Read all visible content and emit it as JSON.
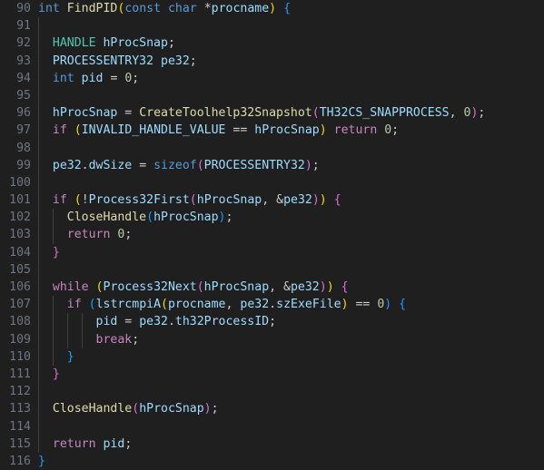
{
  "editor": {
    "name": "code-editor",
    "theme": "Dark Modern",
    "language": "C",
    "background": "#1f1f1f",
    "gutter_color": "#6e7681",
    "indent_guide_color": "#404040",
    "first_line_number": 90,
    "last_line_number": 116,
    "line_height_px": 19.19,
    "font_size_px": 13.2,
    "palette": {
      "keyword": "#569cd6",
      "control": "#c586c0",
      "function": "#dcdcaa",
      "type": "#4ec9b0",
      "variable": "#9cdcfe",
      "number": "#b5cea8",
      "plain": "#cccccc",
      "bracket_1": "#ffd700",
      "bracket_2": "#da70d6",
      "bracket_3": "#179fff"
    }
  },
  "lines": [
    {
      "num": "90",
      "text": "int FindPID(const char *procname) {",
      "guides": 0
    },
    {
      "num": "91",
      "text": "",
      "guides": 1
    },
    {
      "num": "92",
      "text": "  HANDLE hProcSnap;",
      "guides": 1
    },
    {
      "num": "93",
      "text": "  PROCESSENTRY32 pe32;",
      "guides": 1
    },
    {
      "num": "94",
      "text": "  int pid = 0;",
      "guides": 1
    },
    {
      "num": "95",
      "text": "",
      "guides": 1
    },
    {
      "num": "96",
      "text": "  hProcSnap = CreateToolhelp32Snapshot(TH32CS_SNAPPROCESS, 0);",
      "guides": 1
    },
    {
      "num": "97",
      "text": "  if (INVALID_HANDLE_VALUE == hProcSnap) return 0;",
      "guides": 1
    },
    {
      "num": "98",
      "text": "",
      "guides": 1
    },
    {
      "num": "99",
      "text": "  pe32.dwSize = sizeof(PROCESSENTRY32);",
      "guides": 1
    },
    {
      "num": "100",
      "text": "",
      "guides": 1
    },
    {
      "num": "101",
      "text": "  if (!Process32First(hProcSnap, &pe32)) {",
      "guides": 1
    },
    {
      "num": "102",
      "text": "    CloseHandle(hProcSnap);",
      "guides": 2
    },
    {
      "num": "103",
      "text": "    return 0;",
      "guides": 2
    },
    {
      "num": "104",
      "text": "  }",
      "guides": 1
    },
    {
      "num": "105",
      "text": "",
      "guides": 1
    },
    {
      "num": "106",
      "text": "  while (Process32Next(hProcSnap, &pe32)) {",
      "guides": 1
    },
    {
      "num": "107",
      "text": "    if (lstrcmpiA(procname, pe32.szExeFile) == 0) {",
      "guides": 2
    },
    {
      "num": "108",
      "text": "        pid = pe32.th32ProcessID;",
      "guides": 4
    },
    {
      "num": "109",
      "text": "        break;",
      "guides": 4
    },
    {
      "num": "110",
      "text": "    }",
      "guides": 2
    },
    {
      "num": "111",
      "text": "  }",
      "guides": 1
    },
    {
      "num": "112",
      "text": "",
      "guides": 1
    },
    {
      "num": "113",
      "text": "  CloseHandle(hProcSnap);",
      "guides": 1
    },
    {
      "num": "114",
      "text": "",
      "guides": 1
    },
    {
      "num": "115",
      "text": "  return pid;",
      "guides": 1
    },
    {
      "num": "116",
      "text": "}",
      "guides": 0
    }
  ],
  "tokens": {
    "90": [
      [
        "kw",
        "int"
      ],
      [
        "plain",
        " "
      ],
      [
        "fn",
        "FindPID"
      ],
      [
        "p0",
        "("
      ],
      [
        "kw",
        "const"
      ],
      [
        "plain",
        " "
      ],
      [
        "kw",
        "char"
      ],
      [
        "plain",
        " "
      ],
      [
        "op",
        "*"
      ],
      [
        "var",
        "procname"
      ],
      [
        "p0",
        ")"
      ],
      [
        "plain",
        " "
      ],
      [
        "p2",
        "{"
      ]
    ],
    "92": [
      [
        "plain",
        "  "
      ],
      [
        "type",
        "HANDLE"
      ],
      [
        "plain",
        " "
      ],
      [
        "var",
        "hProcSnap"
      ],
      [
        "plain",
        ";"
      ]
    ],
    "93": [
      [
        "plain",
        "  "
      ],
      [
        "var",
        "PROCESSENTRY32"
      ],
      [
        "plain",
        " "
      ],
      [
        "var",
        "pe32"
      ],
      [
        "plain",
        ";"
      ]
    ],
    "94": [
      [
        "plain",
        "  "
      ],
      [
        "kw",
        "int"
      ],
      [
        "plain",
        " "
      ],
      [
        "var",
        "pid"
      ],
      [
        "plain",
        " = "
      ],
      [
        "num",
        "0"
      ],
      [
        "plain",
        ";"
      ]
    ],
    "96": [
      [
        "plain",
        "  "
      ],
      [
        "var",
        "hProcSnap"
      ],
      [
        "plain",
        " = "
      ],
      [
        "fn",
        "CreateToolhelp32Snapshot"
      ],
      [
        "p1",
        "("
      ],
      [
        "var",
        "TH32CS_SNAPPROCESS"
      ],
      [
        "plain",
        ", "
      ],
      [
        "num",
        "0"
      ],
      [
        "p1",
        ")"
      ],
      [
        "plain",
        ";"
      ]
    ],
    "97": [
      [
        "plain",
        "  "
      ],
      [
        "ctrl",
        "if"
      ],
      [
        "plain",
        " "
      ],
      [
        "p0",
        "("
      ],
      [
        "var",
        "INVALID_HANDLE_VALUE"
      ],
      [
        "plain",
        " == "
      ],
      [
        "var",
        "hProcSnap"
      ],
      [
        "p0",
        ")"
      ],
      [
        "plain",
        " "
      ],
      [
        "ctrl",
        "return"
      ],
      [
        "plain",
        " "
      ],
      [
        "num",
        "0"
      ],
      [
        "plain",
        ";"
      ]
    ],
    "99": [
      [
        "plain",
        "  "
      ],
      [
        "var",
        "pe32"
      ],
      [
        "plain",
        "."
      ],
      [
        "var",
        "dwSize"
      ],
      [
        "plain",
        " = "
      ],
      [
        "kw",
        "sizeof"
      ],
      [
        "p1",
        "("
      ],
      [
        "var",
        "PROCESSENTRY32"
      ],
      [
        "p1",
        ")"
      ],
      [
        "plain",
        ";"
      ]
    ],
    "101": [
      [
        "plain",
        "  "
      ],
      [
        "ctrl",
        "if"
      ],
      [
        "plain",
        " "
      ],
      [
        "p0",
        "("
      ],
      [
        "op",
        "!"
      ],
      [
        "call",
        "Process32First"
      ],
      [
        "p1",
        "("
      ],
      [
        "var",
        "hProcSnap"
      ],
      [
        "plain",
        ", "
      ],
      [
        "op",
        "&"
      ],
      [
        "var",
        "pe32"
      ],
      [
        "p1",
        ")"
      ],
      [
        "p0",
        ")"
      ],
      [
        "plain",
        " "
      ],
      [
        "p1",
        "{"
      ]
    ],
    "102": [
      [
        "plain",
        "    "
      ],
      [
        "fn",
        "CloseHandle"
      ],
      [
        "p2",
        "("
      ],
      [
        "var",
        "hProcSnap"
      ],
      [
        "p2",
        ")"
      ],
      [
        "plain",
        ";"
      ]
    ],
    "103": [
      [
        "plain",
        "    "
      ],
      [
        "ctrl",
        "return"
      ],
      [
        "plain",
        " "
      ],
      [
        "num",
        "0"
      ],
      [
        "plain",
        ";"
      ]
    ],
    "104": [
      [
        "plain",
        "  "
      ],
      [
        "p1",
        "}"
      ]
    ],
    "106": [
      [
        "plain",
        "  "
      ],
      [
        "ctrl",
        "while"
      ],
      [
        "plain",
        " "
      ],
      [
        "p0",
        "("
      ],
      [
        "call",
        "Process32Next"
      ],
      [
        "p1",
        "("
      ],
      [
        "var",
        "hProcSnap"
      ],
      [
        "plain",
        ", "
      ],
      [
        "op",
        "&"
      ],
      [
        "var",
        "pe32"
      ],
      [
        "p1",
        ")"
      ],
      [
        "p0",
        ")"
      ],
      [
        "plain",
        " "
      ],
      [
        "p1",
        "{"
      ]
    ],
    "107": [
      [
        "plain",
        "    "
      ],
      [
        "ctrl",
        "if"
      ],
      [
        "plain",
        " "
      ],
      [
        "p2",
        "("
      ],
      [
        "call",
        "lstrcmpiA"
      ],
      [
        "p0",
        "("
      ],
      [
        "var",
        "procname"
      ],
      [
        "plain",
        ", "
      ],
      [
        "var",
        "pe32"
      ],
      [
        "plain",
        "."
      ],
      [
        "var",
        "szExeFile"
      ],
      [
        "p0",
        ")"
      ],
      [
        "plain",
        " == "
      ],
      [
        "num",
        "0"
      ],
      [
        "p2",
        ")"
      ],
      [
        "plain",
        " "
      ],
      [
        "p2",
        "{"
      ]
    ],
    "108": [
      [
        "plain",
        "        "
      ],
      [
        "var",
        "pid"
      ],
      [
        "plain",
        " = "
      ],
      [
        "var",
        "pe32"
      ],
      [
        "plain",
        "."
      ],
      [
        "var",
        "th32ProcessID"
      ],
      [
        "plain",
        ";"
      ]
    ],
    "109": [
      [
        "plain",
        "        "
      ],
      [
        "ctrl",
        "break"
      ],
      [
        "plain",
        ";"
      ]
    ],
    "110": [
      [
        "plain",
        "    "
      ],
      [
        "p2",
        "}"
      ]
    ],
    "111": [
      [
        "plain",
        "  "
      ],
      [
        "p1",
        "}"
      ]
    ],
    "113": [
      [
        "plain",
        "  "
      ],
      [
        "fn",
        "CloseHandle"
      ],
      [
        "p1",
        "("
      ],
      [
        "var",
        "hProcSnap"
      ],
      [
        "p1",
        ")"
      ],
      [
        "plain",
        ";"
      ]
    ],
    "115": [
      [
        "plain",
        "  "
      ],
      [
        "ctrl",
        "return"
      ],
      [
        "plain",
        " "
      ],
      [
        "var",
        "pid"
      ],
      [
        "plain",
        ";"
      ]
    ],
    "116": [
      [
        "p2",
        "}"
      ]
    ]
  },
  "code_full": "int FindPID(const char *procname) {\n\n  HANDLE hProcSnap;\n  PROCESSENTRY32 pe32;\n  int pid = 0;\n\n  hProcSnap = CreateToolhelp32Snapshot(TH32CS_SNAPPROCESS, 0);\n  if (INVALID_HANDLE_VALUE == hProcSnap) return 0;\n\n  pe32.dwSize = sizeof(PROCESSENTRY32);\n\n  if (!Process32First(hProcSnap, &pe32)) {\n    CloseHandle(hProcSnap);\n    return 0;\n  }\n\n  while (Process32Next(hProcSnap, &pe32)) {\n    if (lstrcmpiA(procname, pe32.szExeFile) == 0) {\n        pid = pe32.th32ProcessID;\n        break;\n    }\n  }\n\n  CloseHandle(hProcSnap);\n\n  return pid;\n}"
}
